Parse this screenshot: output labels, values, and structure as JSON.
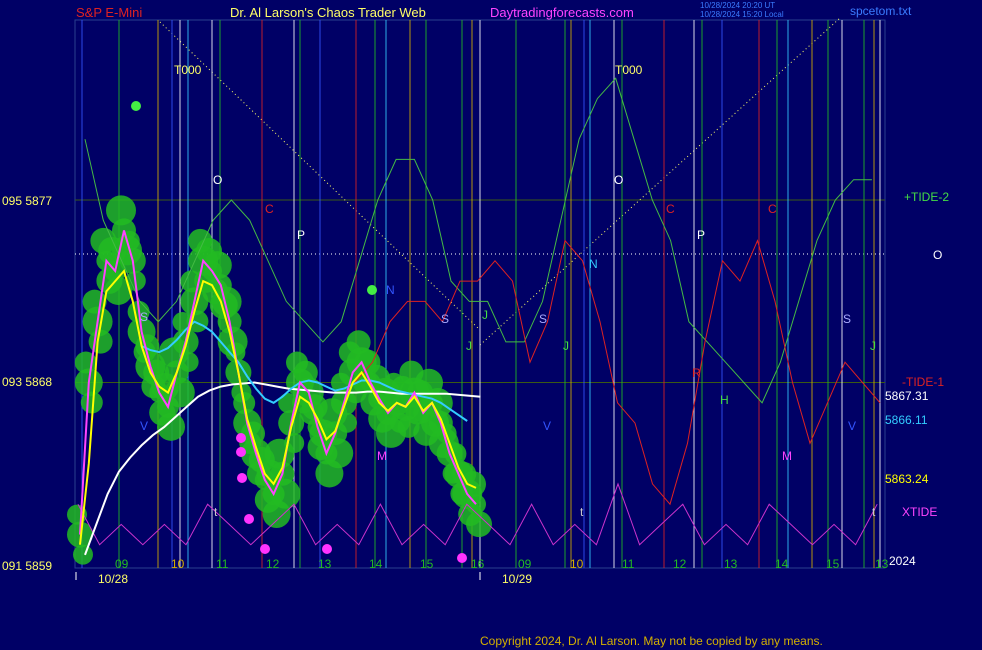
{
  "header": {
    "symbol": "S&P E-Mini",
    "site_title": "Dr. Al Larson's Chaos Trader Web",
    "url": "Daytradingforecasts.com",
    "stamp_utc": "10/28/2024 20:20 UT",
    "stamp_local": "10/28/2024 15:20 Local",
    "file": "spcetom.txt"
  },
  "colors": {
    "background": "#000066",
    "price_bar": "#ff44ff",
    "green_bubble": "#22bb22",
    "fast_ma": "#ffff00",
    "mid_ma": "#33ccff",
    "slow_ma": "#ffffff",
    "tide1": "#dd2222",
    "tide2": "#44bb44",
    "xtide": "#cc33cc",
    "grid": "#3c5a14"
  },
  "footer": {
    "copyright": "Copyright 2024, Dr. Al Larson. May not be copied by any means."
  },
  "chart_data": {
    "type": "line",
    "title": "S&P E-Mini",
    "y_left_labels": [
      {
        "text": "095  5877",
        "price": 5877
      },
      {
        "text": "093  5868",
        "price": 5868
      },
      {
        "text": "091  5859",
        "price": 5859
      }
    ],
    "ylim": [
      5859,
      5877
    ],
    "x_date_labels": [
      "10/28",
      "10/29"
    ],
    "x_hour_labels": [
      "09",
      "10",
      "11",
      "12",
      "13",
      "14",
      "15",
      "16",
      "09",
      "10",
      "11",
      "12",
      "13",
      "14",
      "15",
      "13"
    ],
    "x_hour_colors": [
      "#22bb22",
      "#d4b000",
      "#22bb22",
      "#22bb22",
      "#22bb22",
      "#22bb22",
      "#22bb22",
      "#22bb22",
      "#22bb22",
      "#d4b000",
      "#22bb22",
      "#22bb22",
      "#22bb22",
      "#22bb22",
      "#22bb22",
      "#22bb22"
    ],
    "right_labels": [
      {
        "text": "+TIDE-2",
        "color": "#44dd44"
      },
      {
        "text": "O",
        "color": "#ffffff"
      },
      {
        "text": "-TIDE-1",
        "color": "#dd2222"
      },
      {
        "text": "5867.31",
        "color": "#ffffff"
      },
      {
        "text": "5866.11",
        "color": "#33ccff"
      },
      {
        "text": "5863.24",
        "color": "#ffff00"
      },
      {
        "text": "XTIDE",
        "color": "#ff44ff"
      },
      {
        "text": "2024",
        "color": "#ffffff"
      }
    ],
    "annotations": [
      {
        "text": "T000",
        "color": "#ffff66"
      },
      {
        "text": "T000",
        "color": "#ffff66"
      },
      {
        "text": "O",
        "color": "#ffffff"
      },
      {
        "text": "O",
        "color": "#ffffff"
      },
      {
        "text": "C",
        "color": "#dd2222"
      },
      {
        "text": "C",
        "color": "#dd2222"
      },
      {
        "text": "C",
        "color": "#dd2222"
      },
      {
        "text": "P",
        "color": "#ffffff"
      },
      {
        "text": "P",
        "color": "#ffffff"
      },
      {
        "text": "S",
        "color": "#aaaaff"
      },
      {
        "text": "S",
        "color": "#aaaaff"
      },
      {
        "text": "S",
        "color": "#aaaaff"
      },
      {
        "text": "S",
        "color": "#aaaaff"
      },
      {
        "text": "N",
        "color": "#33ccff"
      },
      {
        "text": "N",
        "color": "#3355ff"
      },
      {
        "text": "M",
        "color": "#ff44ff"
      },
      {
        "text": "M",
        "color": "#ff44ff"
      },
      {
        "text": "H",
        "color": "#44dd44"
      },
      {
        "text": "J",
        "color": "#44dd44"
      },
      {
        "text": "J",
        "color": "#44dd44"
      },
      {
        "text": "J",
        "color": "#44dd44"
      },
      {
        "text": "J",
        "color": "#44dd44"
      },
      {
        "text": "V",
        "color": "#3355ff"
      },
      {
        "text": "V",
        "color": "#3355ff"
      },
      {
        "text": "V",
        "color": "#3355ff"
      },
      {
        "text": "R",
        "color": "#dd2222"
      },
      {
        "text": "t",
        "color": "#cccccc"
      },
      {
        "text": "t",
        "color": "#cccccc"
      },
      {
        "text": "t",
        "color": "#cccccc"
      }
    ],
    "series": [
      {
        "name": "price",
        "values": [
          5860.5,
          5868.0,
          5871.0,
          5874.0,
          5873.5,
          5875.5,
          5874.0,
          5870.5,
          5868.8,
          5867.5,
          5866.8,
          5868.5,
          5870.0,
          5872.0,
          5874.0,
          5873.5,
          5872.8,
          5871.0,
          5868.5,
          5866.0,
          5864.5,
          5863.2,
          5862.5,
          5863.5,
          5866.0,
          5868.0,
          5867.5,
          5865.8,
          5864.5,
          5865.5,
          5867.0,
          5868.5,
          5869.0,
          5868.0,
          5867.2,
          5866.5,
          5867.0,
          5866.8,
          5867.5,
          5866.5,
          5867.0,
          5866.0,
          5864.5,
          5863.5,
          5862.5,
          5862.0
        ]
      },
      {
        "name": "fast MA",
        "values": [
          5860.0,
          5864.0,
          5870.0,
          5872.5,
          5873.0,
          5873.5,
          5872.0,
          5869.8,
          5868.5,
          5867.8,
          5867.5,
          5868.5,
          5869.8,
          5871.5,
          5873.0,
          5872.8,
          5872.0,
          5870.5,
          5868.5,
          5866.2,
          5864.8,
          5863.5,
          5863.0,
          5863.8,
          5865.8,
          5867.3,
          5867.0,
          5866.2,
          5865.2,
          5865.6,
          5866.8,
          5868.0,
          5868.5,
          5867.8,
          5867.0,
          5866.6,
          5867.0,
          5866.8,
          5867.3,
          5866.6,
          5867.0,
          5866.2,
          5865.0,
          5863.8,
          5863.0,
          5862.8
        ]
      },
      {
        "name": "mid MA",
        "values": [
          null,
          null,
          null,
          null,
          null,
          null,
          null,
          5869.8,
          5869.6,
          5869.5,
          5869.7,
          5870.1,
          5870.6,
          5871.0,
          5870.8,
          5870.5,
          5870.0,
          5869.5,
          5869.0,
          5868.3,
          5867.7,
          5867.2,
          5867.0,
          5867.3,
          5867.7,
          5868.0,
          5868.1,
          5868.0,
          5867.8,
          5867.6,
          5867.7,
          5867.9,
          5868.1,
          5868.1,
          5868.0,
          5867.8,
          5867.6,
          5867.5,
          5867.4,
          5867.3,
          5867.2,
          5867.0,
          5866.7,
          5866.4,
          5866.1
        ]
      },
      {
        "name": "slow MA",
        "values": [
          5859.5,
          5861.0,
          5862.5,
          5863.6,
          5864.3,
          5864.9,
          5865.4,
          5865.8,
          5866.3,
          5866.8,
          5867.3,
          5867.6,
          5867.8,
          5867.9,
          5867.95,
          5868.0,
          5867.9,
          5867.8,
          5867.7,
          5867.65,
          5867.6,
          5867.55,
          5867.5,
          5867.5,
          5867.5,
          5867.55,
          5867.55,
          5867.5,
          5867.45,
          5867.45,
          5867.45,
          5867.45,
          5867.45,
          5867.4,
          5867.35,
          5867.3
        ]
      },
      {
        "name": "TIDE-2",
        "values": [
          5880,
          5876,
          5874,
          5872,
          5871,
          5872,
          5874,
          5876,
          5877,
          5876,
          5874,
          5872,
          5871,
          5870,
          5871,
          5874,
          5877,
          5879,
          5879,
          5877,
          5873,
          5872,
          5872,
          5870,
          5870,
          5872,
          5876,
          5880,
          5882,
          5883,
          5880,
          5877,
          5875,
          5871,
          5870,
          5869,
          5868,
          5867,
          5869,
          5872,
          5875,
          5877,
          5878,
          5878
        ]
      },
      {
        "name": "TIDE-1",
        "values": [
          5868,
          5869,
          5871,
          5872,
          5872,
          5871,
          5873,
          5873,
          5874,
          5873,
          5869,
          5871,
          5875,
          5874,
          5871,
          5867,
          5866,
          5863,
          5862,
          5865,
          5870,
          5874,
          5873,
          5875,
          5872,
          5868,
          5865,
          5867,
          5869,
          5868,
          5867
        ]
      },
      {
        "name": "XTIDE",
        "values": [
          5862,
          5860,
          5861,
          5860,
          5861,
          5860,
          5862,
          5861,
          5860,
          5861,
          5862,
          5860,
          5861,
          5860,
          5862,
          5860,
          5861,
          5860,
          5862,
          5861,
          5860,
          5862,
          5860,
          5861,
          5860,
          5863,
          5860,
          5861,
          5862,
          5860,
          5861,
          5860,
          5862,
          5861,
          5860,
          5861,
          5860,
          5862
        ]
      }
    ]
  }
}
